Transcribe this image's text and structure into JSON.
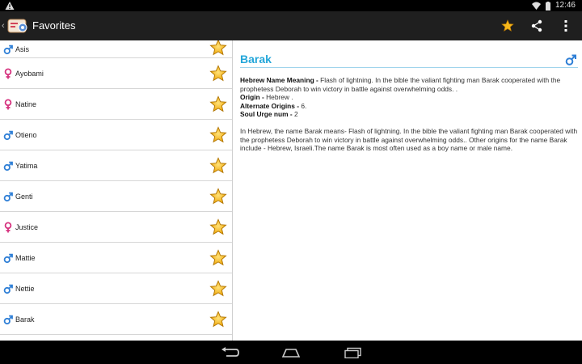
{
  "status_bar": {
    "time": "12:46",
    "warning_icon": "warning-icon",
    "wifi_icon": "wifi-icon",
    "battery_icon": "battery-icon"
  },
  "action_bar": {
    "title": "Favorites",
    "actions": [
      {
        "name": "favorite-star-icon"
      },
      {
        "name": "share-icon"
      },
      {
        "name": "overflow-menu-icon"
      }
    ]
  },
  "favorites": [
    {
      "name": "Asis",
      "gender": "male"
    },
    {
      "name": "Ayobami",
      "gender": "female"
    },
    {
      "name": "Natine",
      "gender": "female"
    },
    {
      "name": "Otieno",
      "gender": "male"
    },
    {
      "name": "Yatima",
      "gender": "male"
    },
    {
      "name": "Genti",
      "gender": "male"
    },
    {
      "name": "Justice",
      "gender": "female"
    },
    {
      "name": "Mattie",
      "gender": "male"
    },
    {
      "name": "Nettie",
      "gender": "male"
    },
    {
      "name": "Barak",
      "gender": "male"
    }
  ],
  "detail": {
    "name": "Barak",
    "gender": "male",
    "meaning_label": "Hebrew Name Meaning - ",
    "meaning_value": "Flash of lightning. In the bible the valiant fighting man Barak cooperated with the prophetess Deborah to win victory in battle against overwhelming odds. .",
    "origin_label": "Origin - ",
    "origin_value": "Hebrew .",
    "alt_origins_label": "Alternate Origins - ",
    "alt_origins_value": " 6.",
    "soul_urge_label": "Soul Urge num - ",
    "soul_urge_value": "2",
    "description": "In Hebrew, the name Barak means- Flash of lightning. In the bible the valiant fighting man Barak cooperated with the prophetess Deborah to win victory in battle against overwhelming odds.. Other origins for the name Barak include - Hebrew, Israeli.The name Barak is most often used as a boy name or male name."
  },
  "colors": {
    "male": "#2f7fd6",
    "female": "#d6337f",
    "accent": "#23a6d9",
    "star": "#f6b81c"
  },
  "nav_bar": {
    "back_icon": "back-icon",
    "home_icon": "home-icon",
    "recents_icon": "recent-apps-icon"
  }
}
